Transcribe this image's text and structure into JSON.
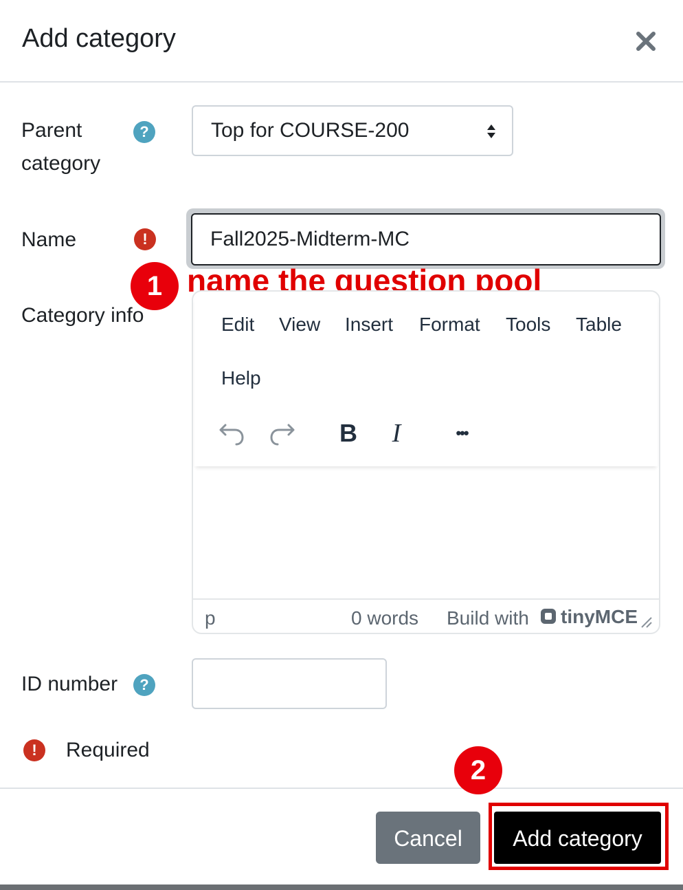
{
  "dialog": {
    "title": "Add category",
    "close_icon": "close-icon"
  },
  "form": {
    "parent_category": {
      "label_line1": "Parent",
      "label_line2": "category",
      "help_icon": "?",
      "selected_value": "Top for COURSE-200"
    },
    "name": {
      "label": "Name",
      "required_icon": "!",
      "value": "Fall2025-Midterm-MC"
    },
    "category_info": {
      "label": "Category info",
      "menu": [
        "Edit",
        "View",
        "Insert",
        "Format",
        "Tools",
        "Table",
        "Help"
      ],
      "toolbar": [
        "undo-icon",
        "redo-icon",
        "bold-icon",
        "italic-icon",
        "more-icon"
      ],
      "bold_glyph": "B",
      "italic_glyph": "I",
      "more_glyph": "•••",
      "status_path": "p",
      "word_count": "0 words",
      "build_with": "Build with",
      "brand": "tinyMCE"
    },
    "id_number": {
      "label": "ID number",
      "help_icon": "?",
      "value": ""
    },
    "required_note": "Required"
  },
  "annotations": {
    "step1_number": "1",
    "step1_text": "name the question pool",
    "step2_number": "2",
    "highlight_color": "#e00000"
  },
  "footer": {
    "cancel_label": "Cancel",
    "submit_label": "Add category"
  },
  "colors": {
    "help_icon": "#4fa3bf",
    "required_icon": "#ca3120",
    "cancel_button": "#6a737b",
    "submit_button": "#000000"
  }
}
